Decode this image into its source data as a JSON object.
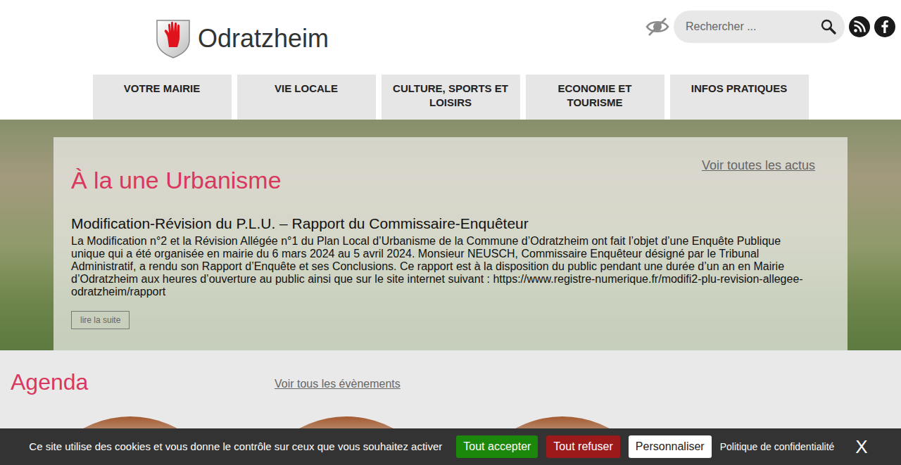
{
  "site": {
    "name": "Odratzheim",
    "search_placeholder": "Rechercher ..."
  },
  "nav": [
    {
      "label": "VOTRE MAIRIE"
    },
    {
      "label": "VIE LOCALE"
    },
    {
      "label": "CULTURE, SPORTS ET LOISIRS"
    },
    {
      "label": "ECONOMIE ET TOURISME"
    },
    {
      "label": "INFOS PRATIQUES"
    }
  ],
  "featured": {
    "heading": "À la une Urbanisme",
    "all_link": "Voir toutes les actus",
    "title": "Modification-Révision du P.L.U. – Rapport du Commissaire-Enquêteur",
    "body": "La Modification n°2 et la Révision Allégée n°1 du Plan Local d’Urbanisme de la Commune d’Odratzheim ont fait l’objet d’une Enquête Publique unique qui a été organisée en mairie du 6 mars 2024 au 5 avril 2024. Monsieur NEUSCH, Commissaire Enquêteur désigné par le Tribunal Administratif, a rendu son Rapport d’Enquête et ses Conclusions. Ce rapport est à la disposition du public pendant une durée d’un an en Mairie d’Odratzheim aux heures d’ouverture au public ainsi que sur le site internet suivant : https://www.registre-numerique.fr/modifi2-plu-revision-allegee-odratzheim/rapport",
    "more": "lire la suite"
  },
  "agenda": {
    "heading": "Agenda",
    "all_link": "Voir tous les évènements",
    "events": [
      {
        "kind": "photo"
      },
      {
        "kind": "photo"
      },
      {
        "kind": "photo"
      }
    ]
  },
  "cookies": {
    "message": "Ce site utilise des cookies et vous donne le contrôle sur ceux que vous souhaitez activer",
    "buttons": [
      {
        "label": "Tout accepter",
        "color": "#1b870b"
      },
      {
        "label": "Tout refuser",
        "color": "#9c1a1a"
      },
      {
        "label": "Personnaliser",
        "color": "#ffffff"
      }
    ],
    "policy": "Politique de confidentialité",
    "close": "X"
  }
}
